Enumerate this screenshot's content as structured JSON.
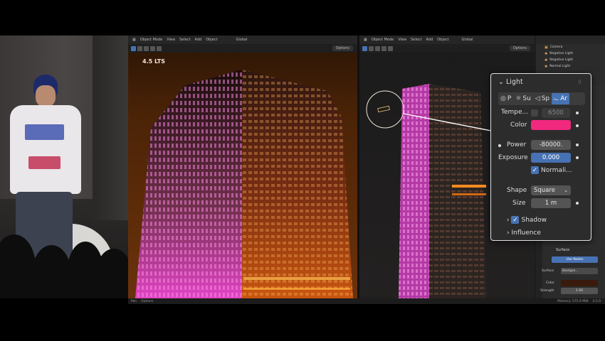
{
  "viewport_left": {
    "mode": "Object Mode",
    "menu": [
      "View",
      "Select",
      "Add",
      "Object"
    ],
    "orientation": "Global",
    "options": "Options",
    "overlay_text": "4.5 LTS"
  },
  "viewport_right": {
    "mode": "Object Mode",
    "menu": [
      "View",
      "Select",
      "Add",
      "Object"
    ],
    "orientation": "Global",
    "options": "Options"
  },
  "outliner": {
    "items": [
      "Camera",
      "Negative Light",
      "Negative Light",
      "Normal Light"
    ]
  },
  "light_panel": {
    "header": "Light",
    "types": [
      "P",
      "Su",
      "Sp",
      "Ar"
    ],
    "temperature_label": "Tempe...",
    "temperature_value": "6500",
    "color_label": "Color",
    "color_value": "#f0287e",
    "power_label": "Power",
    "power_value": "-80000.",
    "exposure_label": "Exposure",
    "exposure_value": "0.000",
    "normalize_label": "Normali...",
    "shape_label": "Shape",
    "shape_value": "Square",
    "size_label": "Size",
    "size_value": "1 m",
    "shadow_label": "Shadow",
    "influence_label": "Influence"
  },
  "properties": {
    "surface_header": "Surface",
    "use_nodes": "Use Nodes",
    "surface_label": "Surface",
    "surface_value": "Backgro...",
    "color_label": "Color",
    "strength_label": "Strength",
    "strength_value": "1.00"
  },
  "status_bar": {
    "left_items": [
      "Pan",
      "Options"
    ],
    "memory": "Memory: 575.9 MiB",
    "version": "4.5.0"
  },
  "colors": {
    "accent": "#4772b3",
    "light_color": "#f0287e",
    "night_orange": "#ff7a10",
    "magenta_glow": "#d33cbf"
  }
}
